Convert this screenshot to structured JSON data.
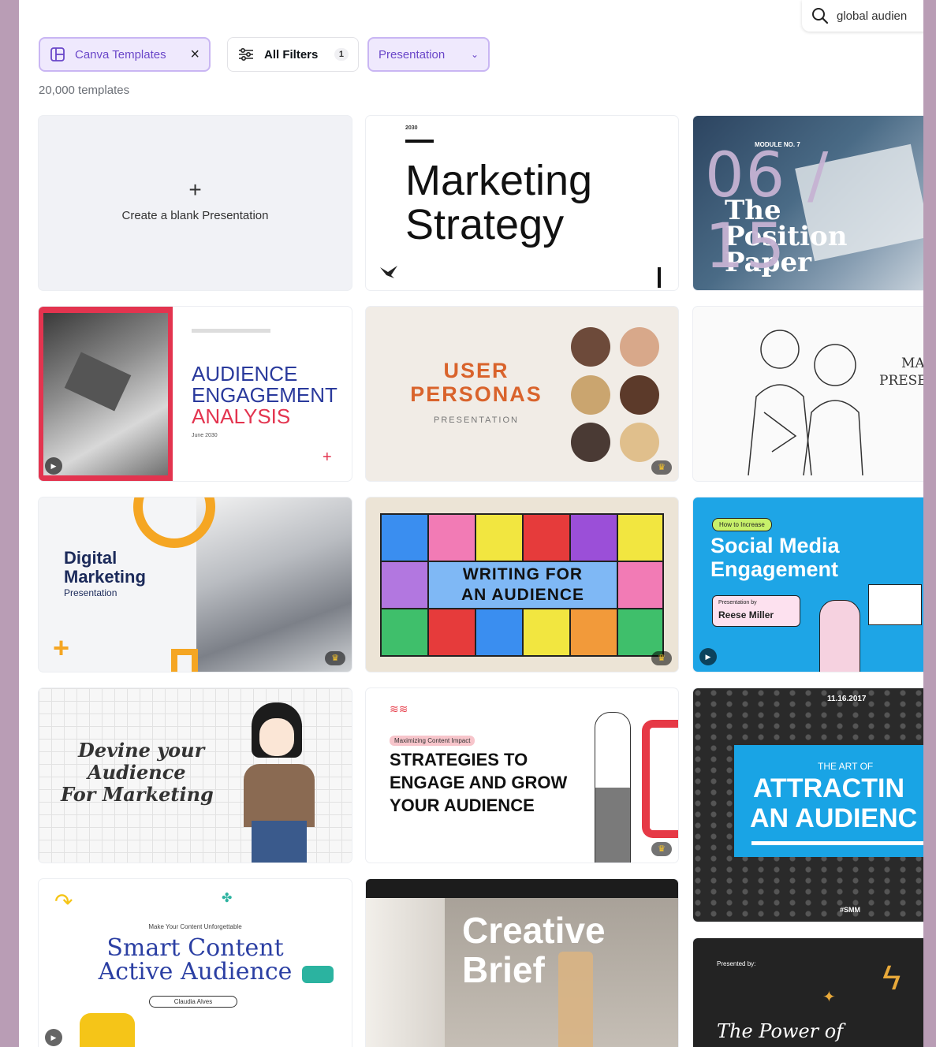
{
  "search": {
    "value": "global audien",
    "icon": "search-icon"
  },
  "filters": {
    "canva_templates": "Canva Templates",
    "all_filters": "All Filters",
    "all_filters_count": "1",
    "presentation": "Presentation"
  },
  "results_count": "20,000 templates",
  "page_counter": "06 / 15",
  "blank": {
    "plus": "+",
    "label": "Create a blank Presentation"
  },
  "templates": {
    "marketing": {
      "year": "2030",
      "line1": "Marketing",
      "line2": "Strategy"
    },
    "position": {
      "module": "MODULE NO. 7",
      "line1": "The",
      "line2": "Position",
      "line3": "Paper"
    },
    "audience_engagement": {
      "line1": "AUDIENCE",
      "line2": "ENGAGEMENT",
      "line3": "ANALYSIS",
      "date": "June 2030"
    },
    "personas": {
      "line1": "USER",
      "line2": "PERSONAS",
      "sub": "PRESENTATION"
    },
    "ma_presentation": {
      "line1": "MA",
      "line2": "PRESE"
    },
    "digital": {
      "line1": "Digital",
      "line2": "Marketing",
      "line3": "Presentation"
    },
    "writing": {
      "line1": "WRITING FOR",
      "line2": "AN AUDIENCE"
    },
    "social": {
      "tag": "How to Increase",
      "line1": "Social Media",
      "line2": "Engagement",
      "by": "Presentation by",
      "name": "Reese Miller"
    },
    "devine": {
      "line1": "Devine your",
      "line2": "Audience",
      "line3": "For Marketing"
    },
    "strategies": {
      "tag": "Maximizing Content Impact",
      "line1": "STRATEGIES TO",
      "line2": "ENGAGE AND GROW",
      "line3": "YOUR AUDIENCE"
    },
    "attracting": {
      "date": "11.16.2017",
      "pre": "THE ART OF",
      "line1": "ATTRACTIN",
      "line2": "AN AUDIENC",
      "tag": "#SMM"
    },
    "smart": {
      "tag": "Make Your Content Unforgettable",
      "line1": "Smart Content",
      "line2": "Active Audience",
      "name": "Claudia Alves"
    },
    "creative": {
      "line1": "Creative",
      "line2": "Brief"
    },
    "power": {
      "presented": "Presented by:",
      "line1": "The Power of"
    }
  },
  "colors": {
    "accent": "#6a47c9",
    "frame": "#b99db5",
    "chip_bg": "#efe9fd"
  }
}
